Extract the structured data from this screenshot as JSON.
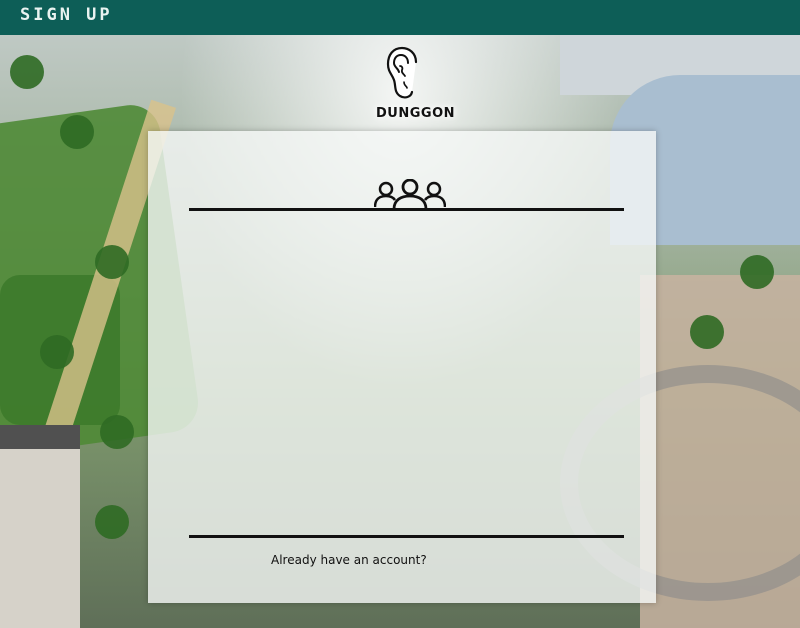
{
  "header": {
    "title": "SIGN UP"
  },
  "logo": {
    "text": "DUNGGON",
    "icon": "ear-icon"
  },
  "panel": {
    "icon": "users-group-icon",
    "signin_prompt": "Already have an account?"
  },
  "colors": {
    "header_bg": "#0d5e57",
    "header_text": "#e9f3f1",
    "panel_bg": "rgba(245,248,246,0.80)",
    "divider": "#111111"
  }
}
